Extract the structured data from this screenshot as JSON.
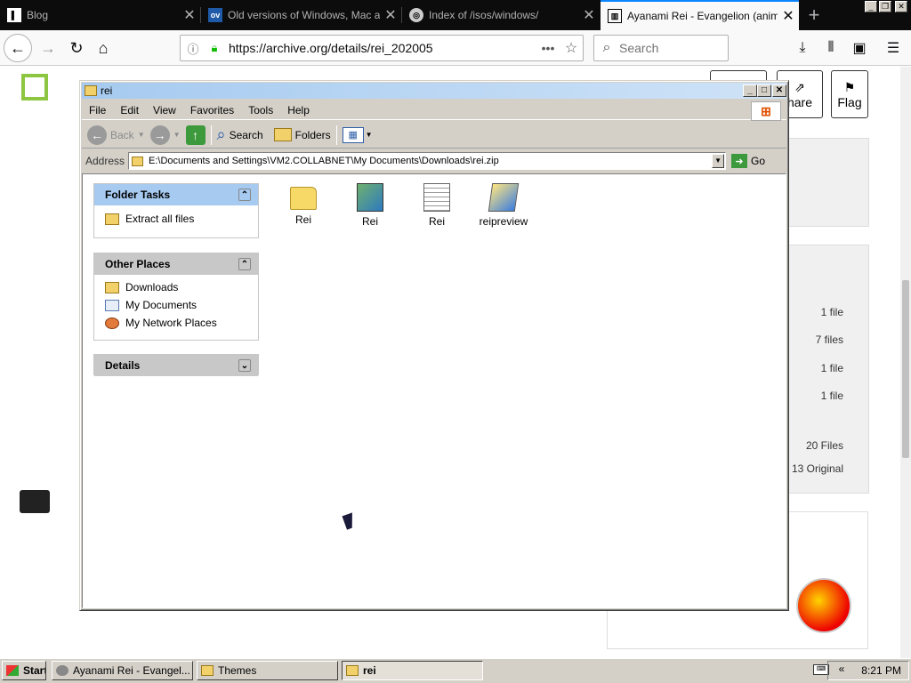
{
  "browser": {
    "tabs": [
      {
        "title": "Blog",
        "active": false
      },
      {
        "title": "Old versions of Windows, Mac an",
        "active": false
      },
      {
        "title": "Index of /isos/windows/",
        "active": false
      },
      {
        "title": "Ayanami Rei - Evangelion (anime",
        "active": true
      }
    ],
    "url": "https://archive.org/details/rei_202005",
    "search_placeholder": "Search"
  },
  "page": {
    "flag_label": "Flag",
    "share_label": "hare",
    "file_counts": [
      "1 file",
      "7 files",
      "1 file",
      "1 file"
    ],
    "total_files": "20 Files",
    "original_count": "13 Original"
  },
  "explorer": {
    "title": "rei",
    "menu": [
      "File",
      "Edit",
      "View",
      "Favorites",
      "Tools",
      "Help"
    ],
    "toolbar": {
      "back": "Back",
      "search": "Search",
      "folders": "Folders"
    },
    "address_label": "Address",
    "address": "E:\\Documents and Settings\\VM2.COLLABNET\\My Documents\\Downloads\\rei.zip",
    "go_label": "Go",
    "folder_tasks": {
      "title": "Folder Tasks",
      "items": [
        {
          "label": "Extract all files",
          "icon": "zip-icon"
        }
      ]
    },
    "other_places": {
      "title": "Other Places",
      "items": [
        {
          "label": "Downloads",
          "icon": "folder-icon"
        },
        {
          "label": "My Documents",
          "icon": "my-documents-icon"
        },
        {
          "label": "My Network Places",
          "icon": "network-places-icon"
        }
      ]
    },
    "details": {
      "title": "Details"
    },
    "files": [
      {
        "name": "Rei",
        "type": "folder"
      },
      {
        "name": "Rei",
        "type": "image"
      },
      {
        "name": "Rei",
        "type": "text"
      },
      {
        "name": "reipreview",
        "type": "executable"
      }
    ]
  },
  "taskbar": {
    "start_label": "Start",
    "buttons": [
      {
        "label": "Ayanami Rei - Evangel...",
        "pressed": false
      },
      {
        "label": "Themes",
        "pressed": false
      },
      {
        "label": "rei",
        "pressed": true
      }
    ],
    "clock": "8:21 PM"
  }
}
